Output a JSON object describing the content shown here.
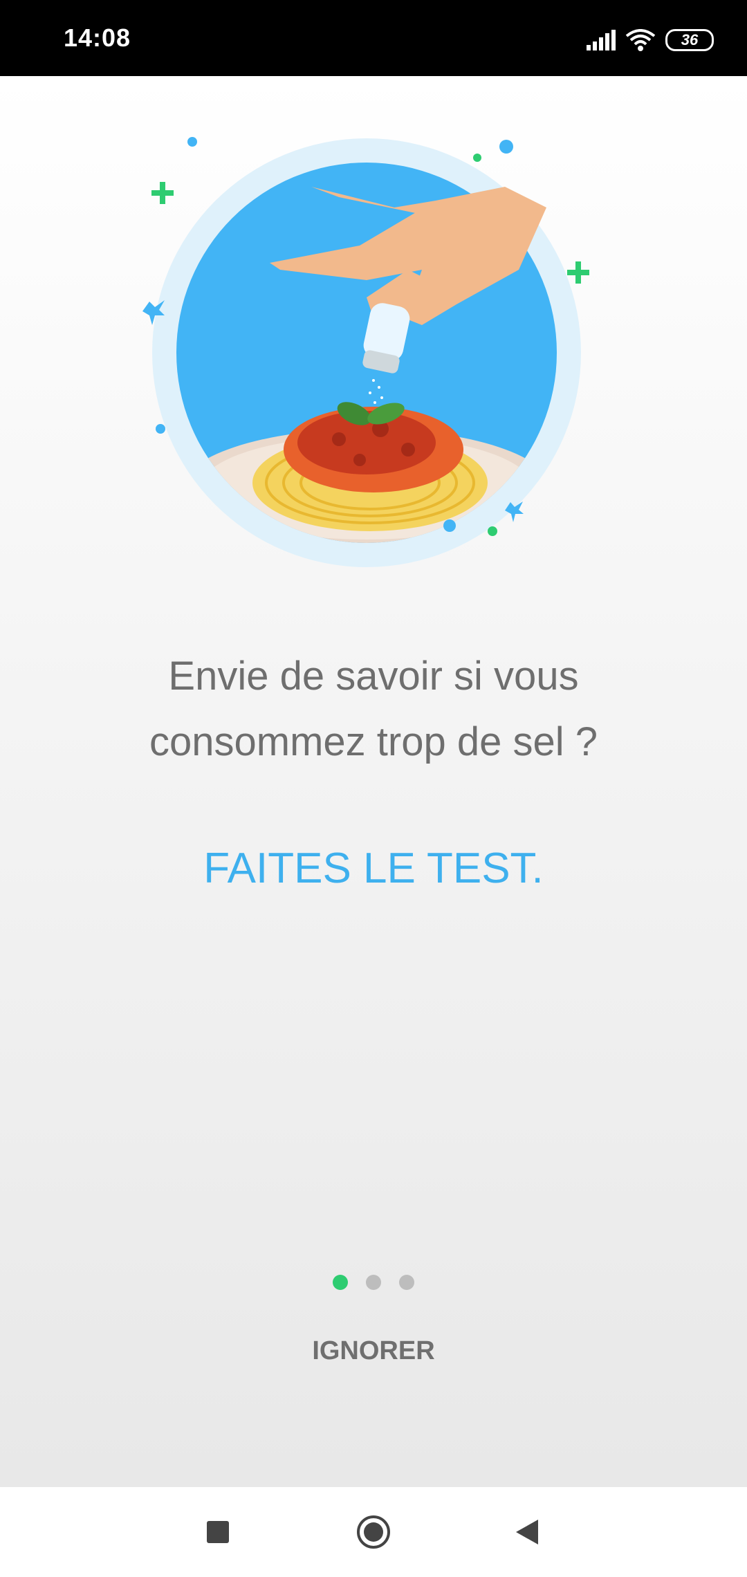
{
  "status_bar": {
    "time": "14:08",
    "battery_level": "36",
    "icons": [
      "signal-icon",
      "wifi-icon",
      "battery-icon"
    ]
  },
  "onboarding": {
    "headline_line1": "Envie de savoir si vous",
    "headline_line2": "consommez trop de sel ?",
    "cta_text": "FAITES LE TEST.",
    "page_indicator": {
      "total": 3,
      "current": 1
    },
    "ignore_label": "IGNORER"
  },
  "colors": {
    "accent_blue": "#3eb0ee",
    "circle_blue": "#42b4f5",
    "active_dot": "#2ecc71",
    "text_gray": "#6e6e6e"
  },
  "nav_bar": {
    "icons": [
      "recents-square-icon",
      "home-circle-icon",
      "back-triangle-icon"
    ]
  }
}
